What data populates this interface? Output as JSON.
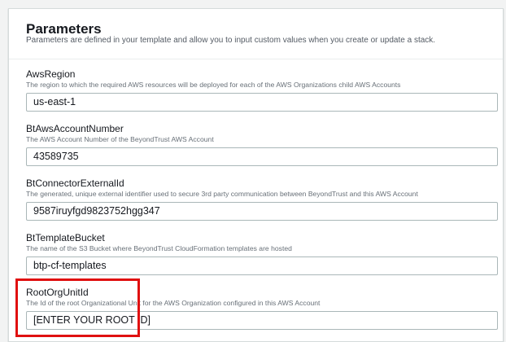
{
  "section": {
    "title": "Parameters",
    "description": "Parameters are defined in your template and allow you to input custom values when you create or update a stack."
  },
  "parameters": [
    {
      "name": "AwsRegion",
      "description": "The region to which the required AWS resources will be deployed for each of the AWS Organizations child AWS Accounts",
      "value": "us-east-1"
    },
    {
      "name": "BtAwsAccountNumber",
      "description": "The AWS Account Number of the BeyondTrust AWS Account",
      "value": "43589735"
    },
    {
      "name": "BtConnectorExternalId",
      "description": "The generated, unique external identifier used to secure 3rd party communication between BeyondTrust and this AWS Account",
      "value": "9587iruyfgd9823752hgg347"
    },
    {
      "name": "BtTemplateBucket",
      "description": "The name of the S3 Bucket where BeyondTrust CloudFormation templates are hosted",
      "value": "btp-cf-templates"
    },
    {
      "name": "RootOrgUnitId",
      "description": "The Id of the root Organizational Unit for the AWS Organization configured in this AWS Account",
      "value": "[ENTER YOUR ROOT ID]"
    }
  ],
  "colors": {
    "highlight": "#e01010",
    "title_text": "#16191f",
    "help_text": "#687078",
    "input_border": "#aab7b8"
  }
}
